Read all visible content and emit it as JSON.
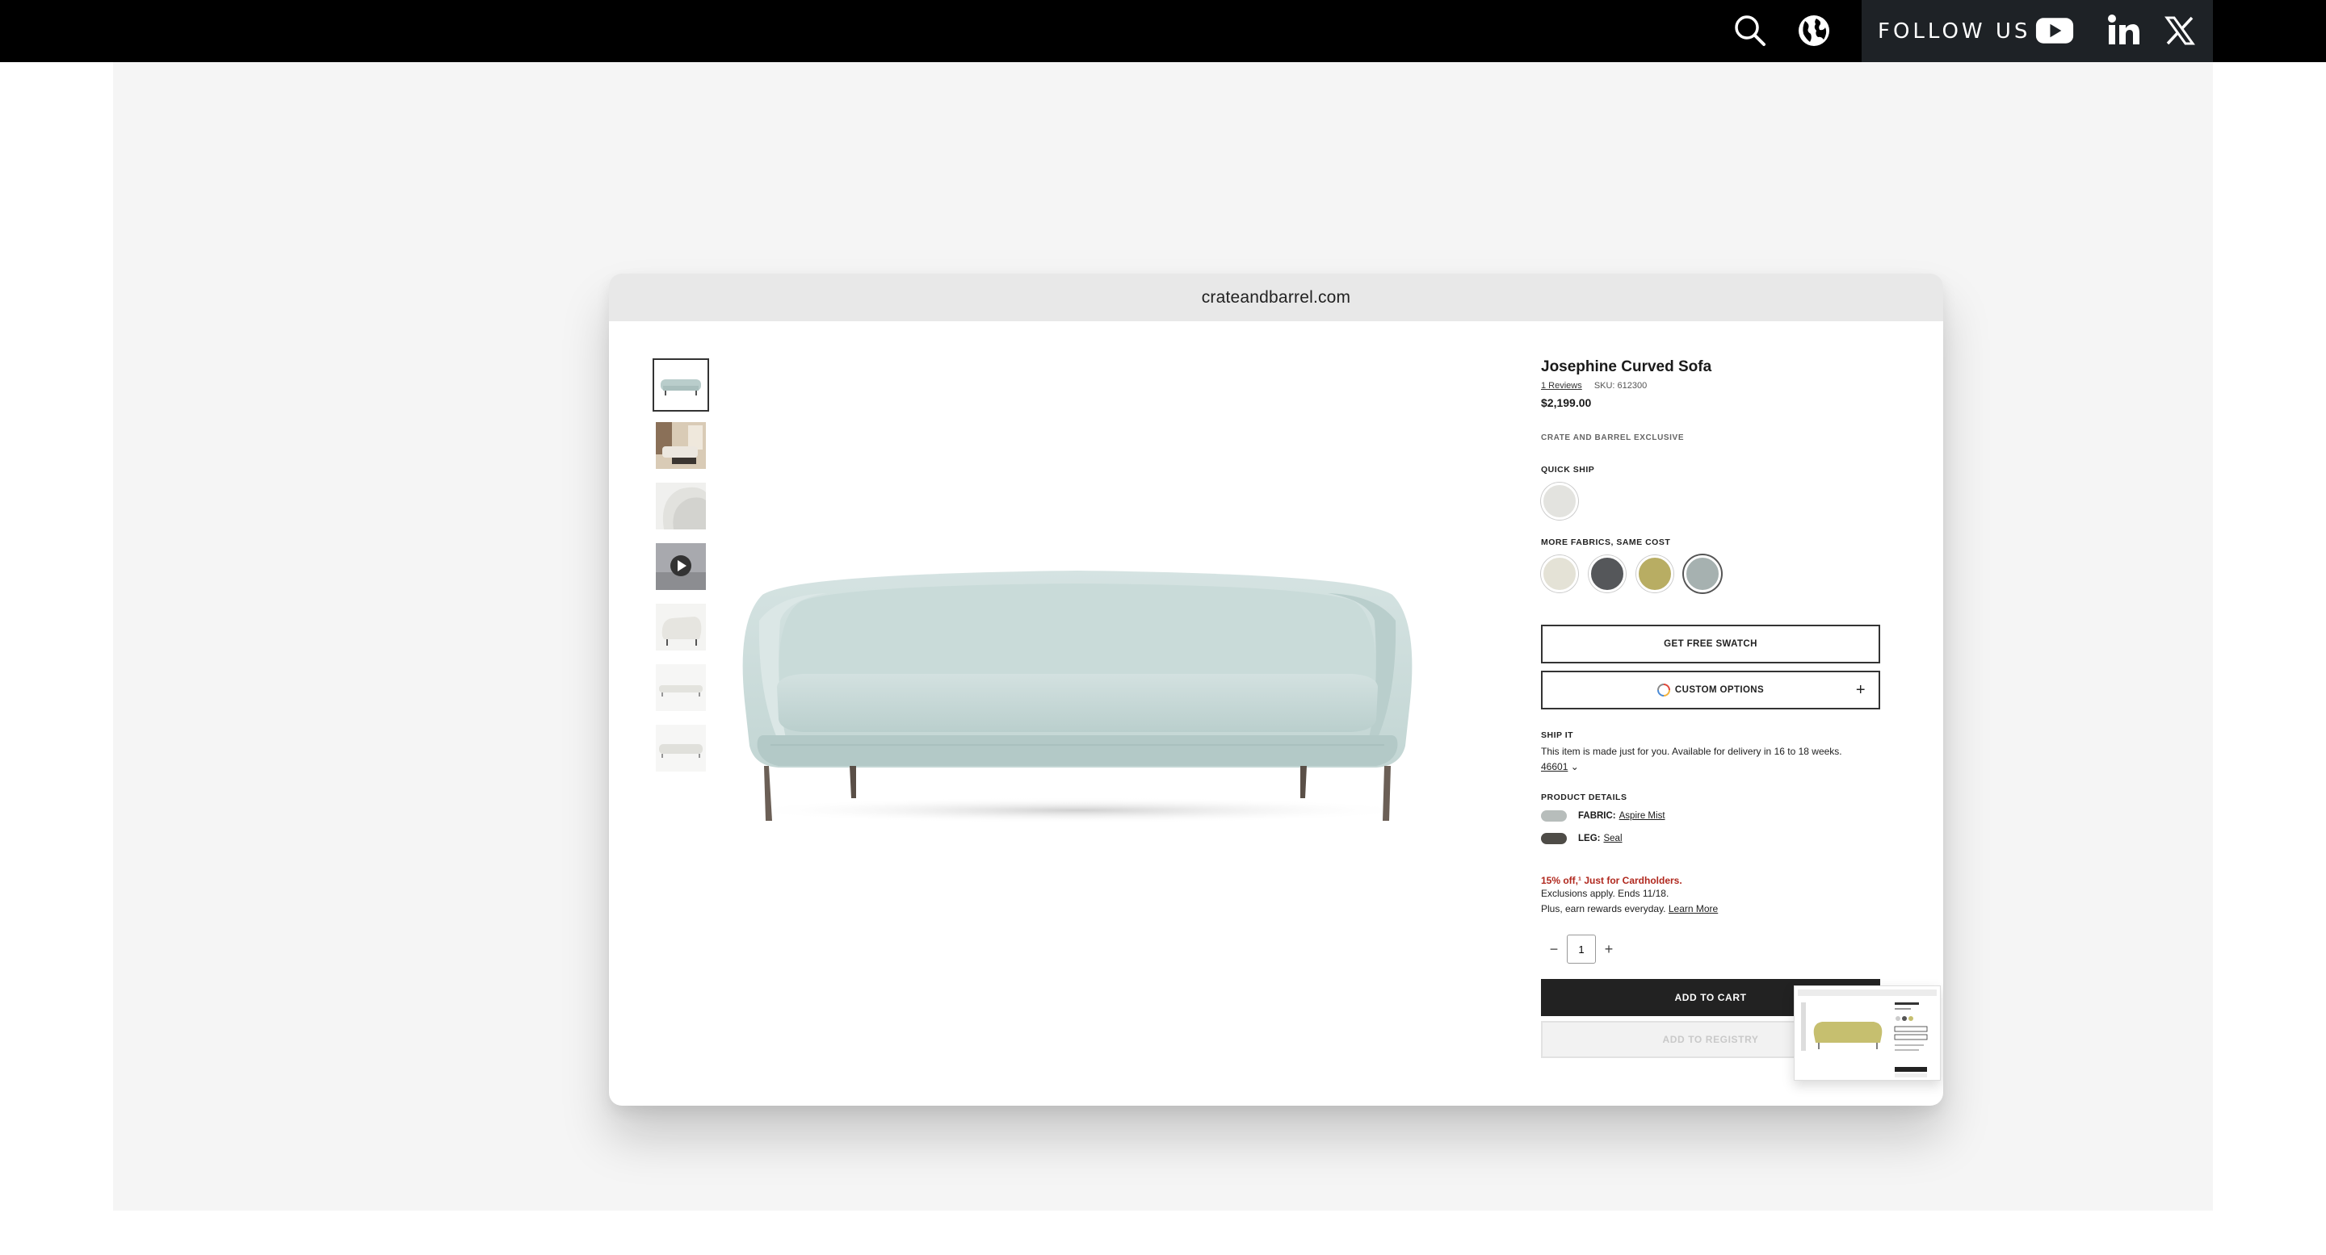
{
  "topbar": {
    "follow_label": "FOLLOW US",
    "icons": [
      "search-icon",
      "globe-icon",
      "youtube-icon",
      "linkedin-icon",
      "x-icon"
    ]
  },
  "browser": {
    "url": "crateandbarrel.com"
  },
  "gallery": {
    "thumbnails": [
      "sofa-front",
      "living-room",
      "sofa-arm",
      "video",
      "sofa-angle",
      "sofa-side",
      "sofa-back"
    ],
    "active_index": 0
  },
  "product": {
    "title": "Josephine Curved Sofa",
    "reviews": "1 Reviews",
    "sku": "SKU: 612300",
    "price": "$2,199.00",
    "exclusive": "CRATE AND BARREL EXCLUSIVE",
    "quick_ship_label": "QUICK SHIP",
    "quick_ship_swatches": [
      "#e3e3df"
    ],
    "more_fabrics_label": "MORE FABRICS, SAME COST",
    "fabric_swatches": [
      "#e4e2d6",
      "#55575a",
      "#b8ad63",
      "#a6b1b0"
    ],
    "selected_fabric_index": 3,
    "free_swatch_label": "GET FREE SWATCH",
    "custom_options_label": "CUSTOM OPTIONS",
    "ship_label": "SHIP IT",
    "ship_text": "This item is made just for you. Available for delivery in 16 to 18 weeks.",
    "zip": "46601",
    "details_label": "PRODUCT DETAILS",
    "fabric_key": "FABRIC:",
    "fabric_value": "Aspire Mist",
    "fabric_color": "#b7bdbb",
    "leg_key": "LEG:",
    "leg_value": "Seal",
    "leg_color": "#4e4c47",
    "promo_title": "15% off,¹ Just for Cardholders.",
    "promo_line1": "Exclusions apply. Ends 11/18.",
    "promo_line2": "Plus, earn rewards everyday.",
    "learn_more": "Learn More",
    "quantity": "1",
    "add_to_cart": "ADD TO CART",
    "add_to_registry": "ADD TO REGISTRY"
  }
}
